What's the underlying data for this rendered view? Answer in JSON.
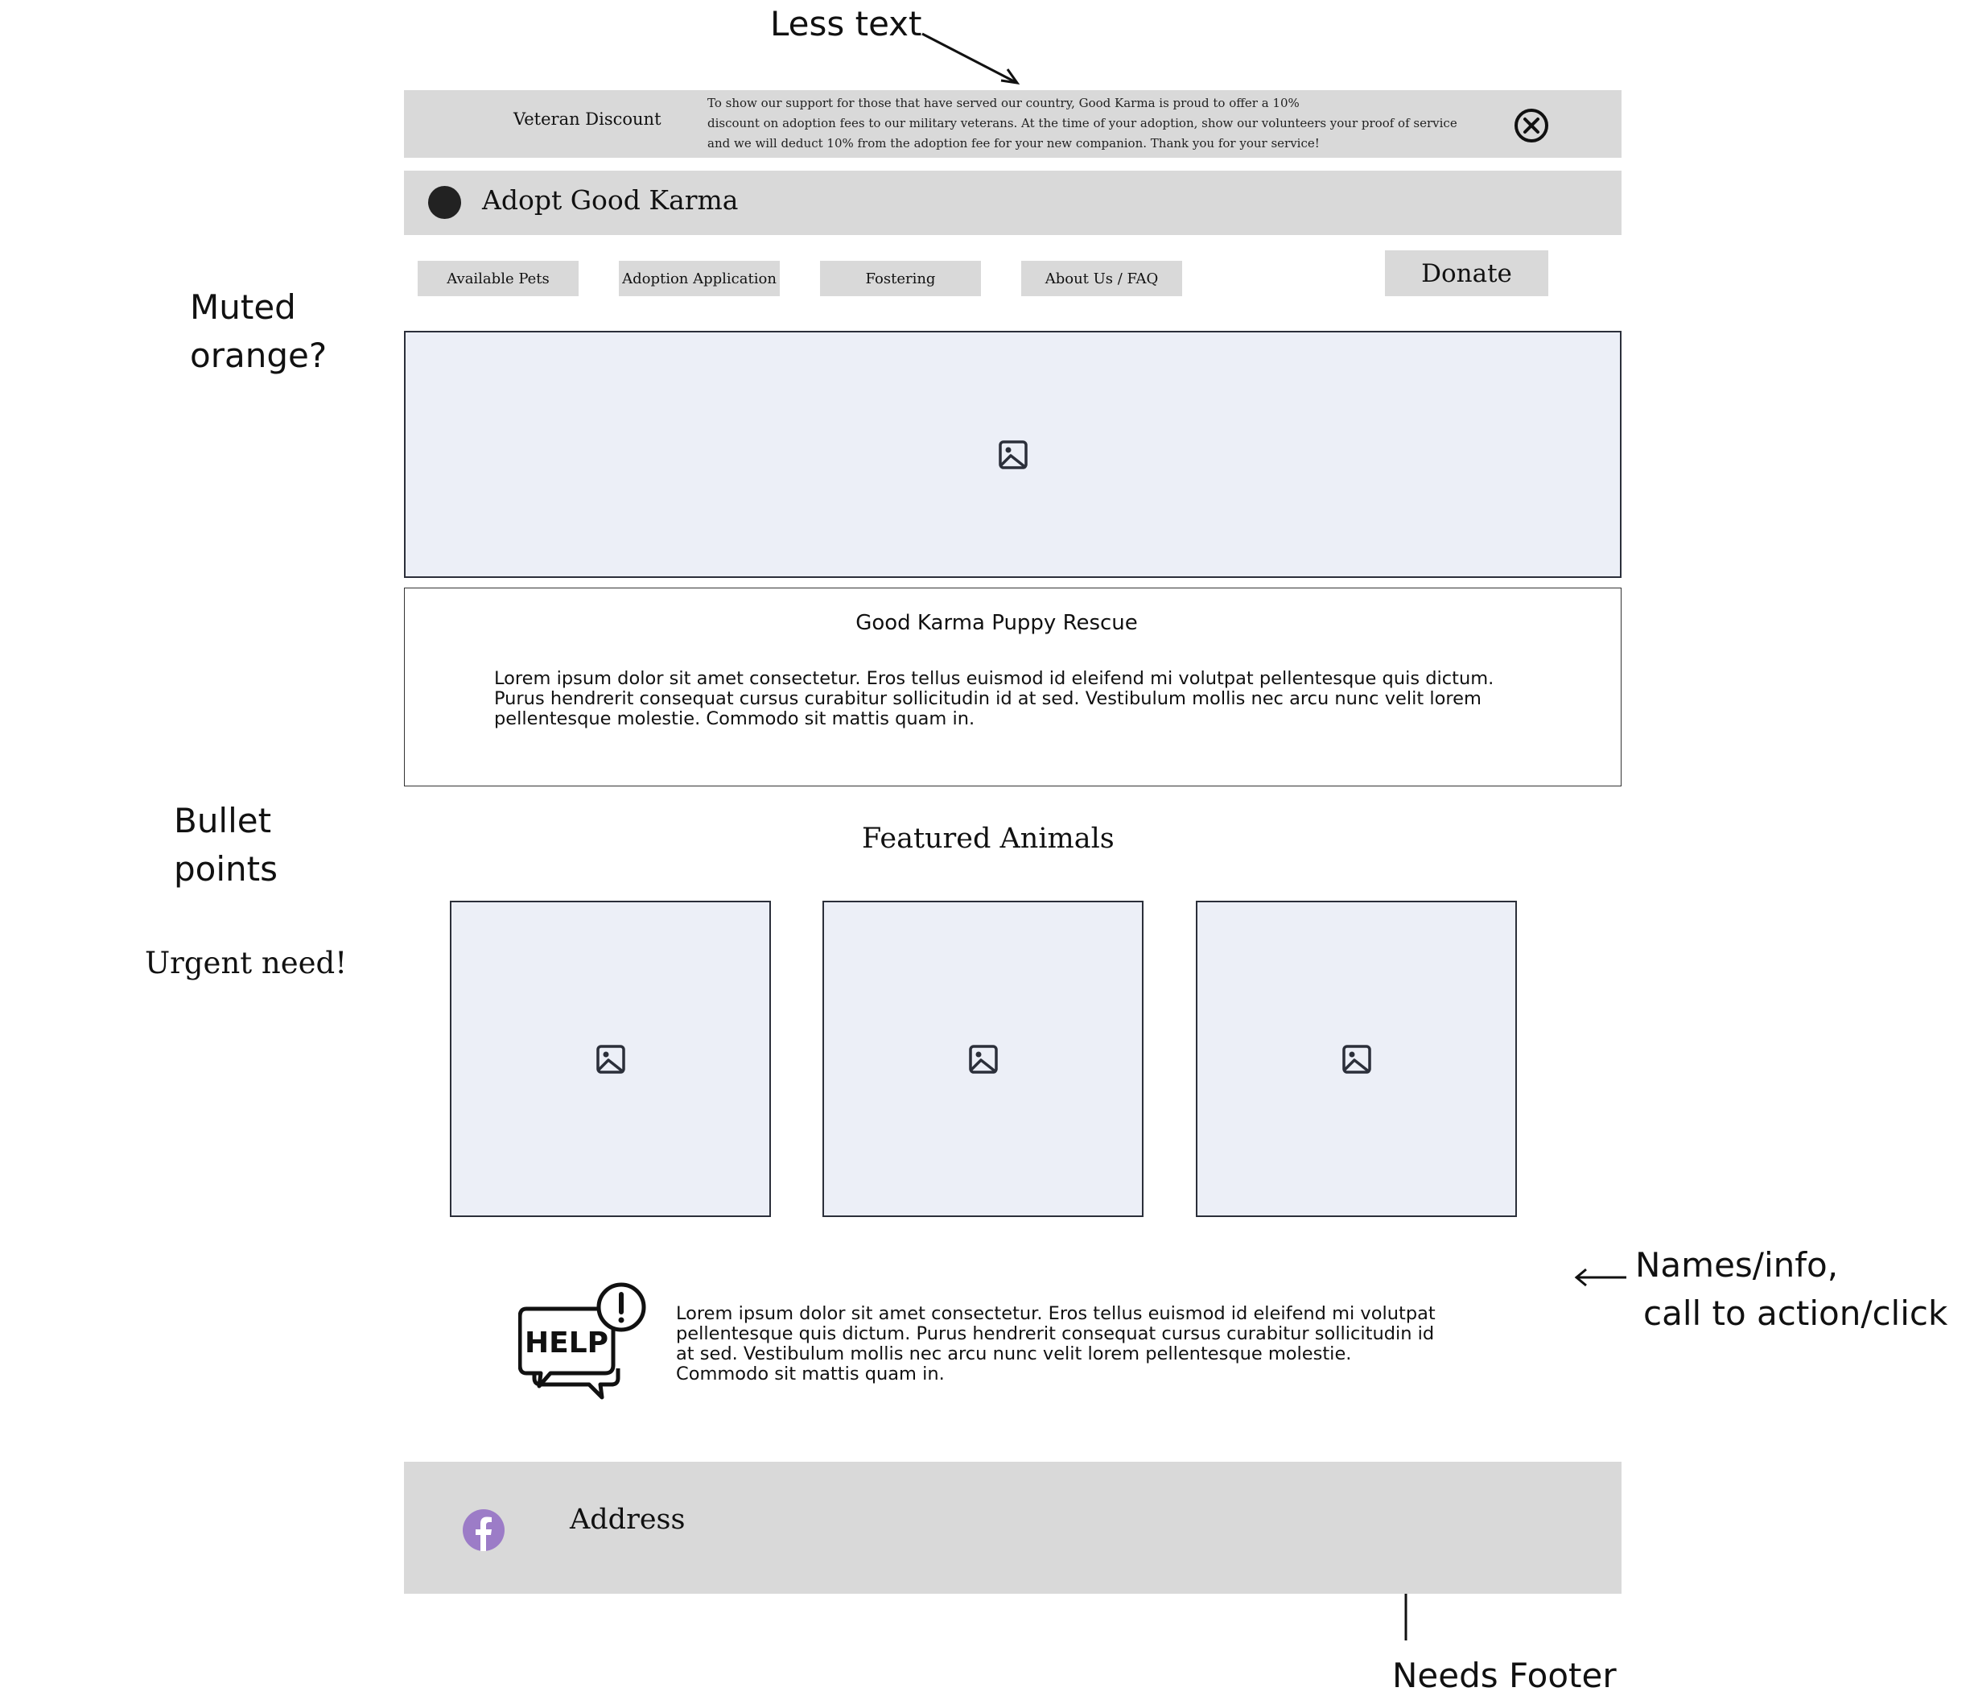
{
  "annotations": {
    "less_text": "Less text",
    "muted_orange": [
      "Muted",
      "orange?"
    ],
    "bullet_points": [
      "Bullet",
      "points"
    ],
    "urgent_need": "Urgent need!",
    "names_info": [
      "Names/info,",
      "call to action/click"
    ],
    "needs_footer": "Needs Footer"
  },
  "banner": {
    "title": "Veteran Discount",
    "text_lines": [
      "To show our support for those that have served our country, Good Karma is proud to offer a 10%",
      "discount on adoption fees to our military veterans. At the time of your adoption, show our volunteers your proof of service",
      "and we will deduct 10% from the adoption fee for your new companion. Thank you for your service!"
    ],
    "close_icon": "close-circle-icon"
  },
  "header": {
    "logo_icon": "logo-circle-icon",
    "site_name": "Adopt Good Karma"
  },
  "nav": {
    "items": [
      "Available Pets",
      "Adoption Application",
      "Fostering",
      "About Us / FAQ"
    ],
    "donate_label": "Donate"
  },
  "about": {
    "title": "Good Karma Puppy Rescue",
    "body_lines": [
      "Lorem ipsum dolor sit amet consectetur. Eros tellus euismod id eleifend mi volutpat pellentesque quis dictum.",
      "Purus hendrerit consequat cursus curabitur sollicitudin id at sed. Vestibulum mollis nec arcu nunc velit lorem",
      "pellentesque molestie. Commodo sit mattis quam in."
    ]
  },
  "featured": {
    "title": "Featured Animals",
    "cards": 3
  },
  "help": {
    "icon_text": "HELP",
    "body_lines": [
      "Lorem ipsum dolor sit amet consectetur. Eros tellus euismod id eleifend mi volutpat",
      "pellentesque quis dictum. Purus hendrerit consequat cursus curabitur sollicitudin id",
      "at sed. Vestibulum mollis nec arcu nunc velit lorem pellentesque molestie.",
      "Commodo sit mattis quam in."
    ]
  },
  "footer": {
    "social_icon": "facebook-icon",
    "address_label": "Address"
  },
  "colors": {
    "bar_gray": "#d9d9d9",
    "placeholder_fill": "#eceff7",
    "facebook_purple": "#9c7cc7"
  }
}
